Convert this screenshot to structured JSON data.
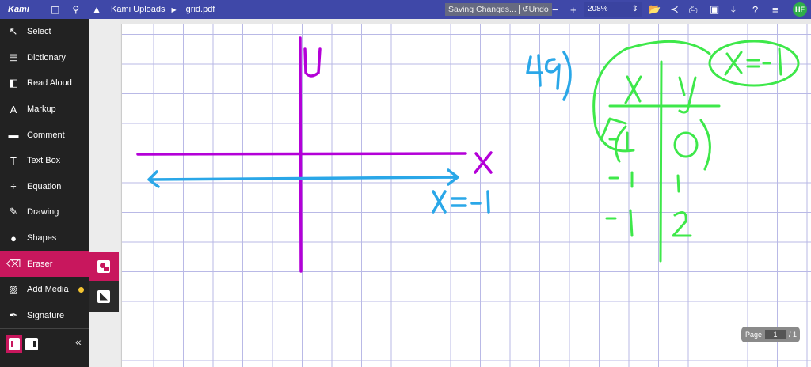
{
  "app": {
    "logo": "Kami",
    "breadcrumb": [
      "Kami Uploads",
      "grid.pdf"
    ],
    "saving": "Saving Changes...",
    "undo": "Undo",
    "zoom": "208%",
    "avatar": "HF"
  },
  "sidebar": {
    "items": [
      {
        "label": "Select",
        "icon": "cursor-icon"
      },
      {
        "label": "Dictionary",
        "icon": "book-icon"
      },
      {
        "label": "Read Aloud",
        "icon": "speaker-icon"
      },
      {
        "label": "Markup",
        "icon": "highlighter-icon"
      },
      {
        "label": "Comment",
        "icon": "comment-icon"
      },
      {
        "label": "Text Box",
        "icon": "text-icon"
      },
      {
        "label": "Equation",
        "icon": "divide-icon"
      },
      {
        "label": "Drawing",
        "icon": "pen-icon"
      },
      {
        "label": "Shapes",
        "icon": "shapes-icon"
      },
      {
        "label": "Eraser",
        "icon": "eraser-icon"
      },
      {
        "label": "Add Media",
        "icon": "image-icon"
      },
      {
        "label": "Signature",
        "icon": "signature-icon"
      }
    ]
  },
  "pager": {
    "label": "Page",
    "current": "1",
    "total": "/ 1"
  },
  "colors": {
    "accent": "#c8175d",
    "topbar": "#3f48a8",
    "purple_ink": "#b400d8",
    "blue_ink": "#2aa7e8",
    "green_ink": "#3ee84a"
  }
}
